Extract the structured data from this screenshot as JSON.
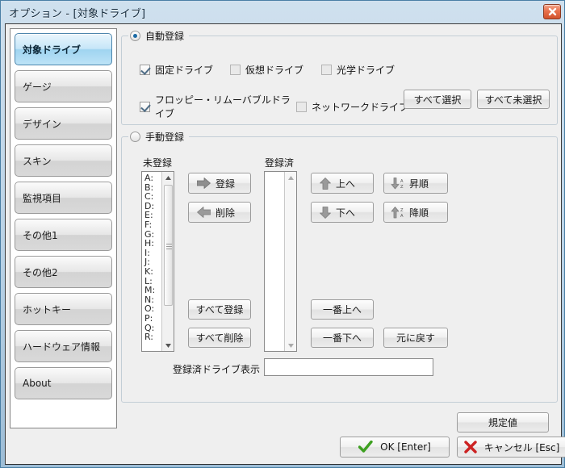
{
  "window": {
    "title": "オプション - [対象ドライブ]",
    "close_icon": "close-icon",
    "accent_color": "#9dbdd6",
    "title_color": "#11273a",
    "close_color": "#d2522c"
  },
  "sidebar": {
    "items": [
      {
        "label": "対象ドライブ",
        "active": true
      },
      {
        "label": "ゲージ",
        "active": false
      },
      {
        "label": "デザイン",
        "active": false
      },
      {
        "label": "スキン",
        "active": false
      },
      {
        "label": "監視項目",
        "active": false
      },
      {
        "label": "その他1",
        "active": false
      },
      {
        "label": "その他2",
        "active": false
      },
      {
        "label": "ホットキー",
        "active": false
      },
      {
        "label": "ハードウェア情報",
        "active": false
      },
      {
        "label": "About",
        "active": false
      }
    ]
  },
  "auto_group": {
    "title": "自動登録",
    "selected": true,
    "checkboxes": [
      {
        "label": "固定ドライブ",
        "checked": true
      },
      {
        "label": "仮想ドライブ",
        "checked": false
      },
      {
        "label": "光学ドライブ",
        "checked": false
      },
      {
        "label": "フロッピー・リムーバブルドライブ",
        "checked": true
      },
      {
        "label": "ネットワークドライブ",
        "checked": false
      }
    ],
    "select_all_label": "すべて選択",
    "deselect_all_label": "すべて未選択"
  },
  "manual_group": {
    "title": "手動登録",
    "selected": false,
    "unregistered_label": "未登録",
    "registered_label": "登録済",
    "unregistered_items": [
      "A:",
      "B:",
      "C:",
      "D:",
      "E:",
      "F:",
      "G:",
      "H:",
      "I:",
      "J:",
      "K:",
      "L:",
      "M:",
      "N:",
      "O:",
      "P:",
      "Q:",
      "R:"
    ],
    "registered_items": [],
    "add_label": "登録",
    "remove_label": "削除",
    "add_all_label": "すべて登録",
    "remove_all_label": "すべて削除",
    "move_up_label": "上へ",
    "move_down_label": "下へ",
    "sort_asc_label": "昇順",
    "sort_desc_label": "降順",
    "sort_asc_hint": "A\nZ",
    "sort_desc_hint": "Z\nA",
    "move_top_label": "一番上へ",
    "move_bottom_label": "一番下へ",
    "reset_label": "元に戻す",
    "display_label": "登録済ドライブ表示",
    "display_value": "",
    "display_placeholder": ""
  },
  "footer": {
    "default_label": "規定値",
    "ok_label": "OK [Enter]",
    "cancel_label": "キャンセル [Esc]",
    "ok_icon": "check-icon",
    "cancel_icon": "cross-icon",
    "ok_color": "#3ea021",
    "cancel_color": "#cc2222"
  }
}
